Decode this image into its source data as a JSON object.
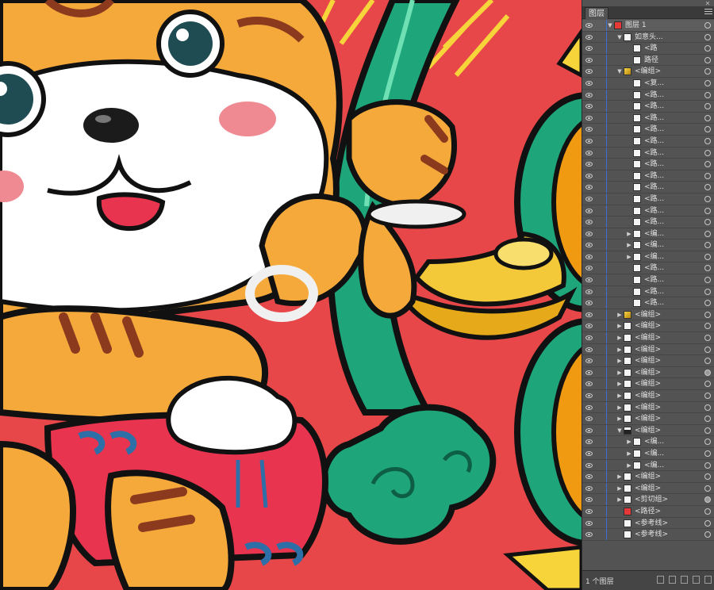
{
  "panel": {
    "tab_label": "图层",
    "close_glyph": "✕",
    "footer_count": "1 个图层",
    "layers": [
      {
        "label": "图层 1",
        "indent": 0,
        "toggle": "▼",
        "thumb": "red",
        "target": "open"
      },
      {
        "label": "如意头...",
        "indent": 1,
        "toggle": "▼",
        "thumb": "plain",
        "target": "open"
      },
      {
        "label": "<路",
        "indent": 2,
        "toggle": "",
        "thumb": "plain",
        "target": "open"
      },
      {
        "label": "路径",
        "indent": 2,
        "toggle": "",
        "thumb": "plain",
        "target": "open"
      },
      {
        "label": "<编组>",
        "indent": 1,
        "toggle": "▼",
        "thumb": "gold",
        "target": "open"
      },
      {
        "label": "<复...",
        "indent": 2,
        "toggle": "",
        "thumb": "plain",
        "target": "open"
      },
      {
        "label": "<路...",
        "indent": 2,
        "toggle": "",
        "thumb": "plain",
        "target": "open"
      },
      {
        "label": "<路...",
        "indent": 2,
        "toggle": "",
        "thumb": "plain",
        "target": "open"
      },
      {
        "label": "<路...",
        "indent": 2,
        "toggle": "",
        "thumb": "plain",
        "target": "open"
      },
      {
        "label": "<路...",
        "indent": 2,
        "toggle": "",
        "thumb": "plain",
        "target": "open"
      },
      {
        "label": "<路...",
        "indent": 2,
        "toggle": "",
        "thumb": "plain",
        "target": "open"
      },
      {
        "label": "<路...",
        "indent": 2,
        "toggle": "",
        "thumb": "plain",
        "target": "open"
      },
      {
        "label": "<路...",
        "indent": 2,
        "toggle": "",
        "thumb": "plain",
        "target": "open"
      },
      {
        "label": "<路...",
        "indent": 2,
        "toggle": "",
        "thumb": "plain",
        "target": "open"
      },
      {
        "label": "<路...",
        "indent": 2,
        "toggle": "",
        "thumb": "plain",
        "target": "open"
      },
      {
        "label": "<路...",
        "indent": 2,
        "toggle": "",
        "thumb": "plain",
        "target": "open"
      },
      {
        "label": "<路...",
        "indent": 2,
        "toggle": "",
        "thumb": "plain",
        "target": "open"
      },
      {
        "label": "<路...",
        "indent": 2,
        "toggle": "",
        "thumb": "plain",
        "target": "open"
      },
      {
        "label": "<编...",
        "indent": 2,
        "toggle": "▶",
        "thumb": "plain",
        "target": "open"
      },
      {
        "label": "<编...",
        "indent": 2,
        "toggle": "▶",
        "thumb": "plain",
        "target": "open"
      },
      {
        "label": "<编...",
        "indent": 2,
        "toggle": "▶",
        "thumb": "plain",
        "target": "open"
      },
      {
        "label": "<路...",
        "indent": 2,
        "toggle": "",
        "thumb": "plain",
        "target": "open"
      },
      {
        "label": "<路...",
        "indent": 2,
        "toggle": "",
        "thumb": "plain",
        "target": "open"
      },
      {
        "label": "<路...",
        "indent": 2,
        "toggle": "",
        "thumb": "plain",
        "target": "open"
      },
      {
        "label": "<路...",
        "indent": 2,
        "toggle": "",
        "thumb": "plain",
        "target": "open"
      },
      {
        "label": "<编组>",
        "indent": 1,
        "toggle": "▶",
        "thumb": "gold",
        "target": "open"
      },
      {
        "label": "<编组>",
        "indent": 1,
        "toggle": "▶",
        "thumb": "plain",
        "target": "open"
      },
      {
        "label": "<编组>",
        "indent": 1,
        "toggle": "▶",
        "thumb": "plain",
        "target": "open"
      },
      {
        "label": "<编组>",
        "indent": 1,
        "toggle": "▶",
        "thumb": "plain",
        "target": "open"
      },
      {
        "label": "<编组>",
        "indent": 1,
        "toggle": "▶",
        "thumb": "plain",
        "target": "open"
      },
      {
        "label": "<编组>",
        "indent": 1,
        "toggle": "▶",
        "thumb": "plain",
        "target": "filled"
      },
      {
        "label": "<编组>",
        "indent": 1,
        "toggle": "▶",
        "thumb": "plain",
        "target": "open"
      },
      {
        "label": "<编组>",
        "indent": 1,
        "toggle": "▶",
        "thumb": "plain",
        "target": "open"
      },
      {
        "label": "<编组>",
        "indent": 1,
        "toggle": "▶",
        "thumb": "plain",
        "target": "open"
      },
      {
        "label": "<编组>",
        "indent": 1,
        "toggle": "▶",
        "thumb": "plain",
        "target": "open"
      },
      {
        "label": "<编组>",
        "indent": 1,
        "toggle": "▼",
        "thumb": "dark",
        "target": "open"
      },
      {
        "label": "<编...",
        "indent": 2,
        "toggle": "▶",
        "thumb": "plain",
        "target": "open"
      },
      {
        "label": "<编...",
        "indent": 2,
        "toggle": "▶",
        "thumb": "plain",
        "target": "open"
      },
      {
        "label": "<编...",
        "indent": 2,
        "toggle": "▶",
        "thumb": "plain",
        "target": "open"
      },
      {
        "label": "<编组>",
        "indent": 1,
        "toggle": "▶",
        "thumb": "plain",
        "target": "open"
      },
      {
        "label": "<编组>",
        "indent": 1,
        "toggle": "▶",
        "thumb": "plain",
        "target": "open"
      },
      {
        "label": "<剪切组>",
        "indent": 1,
        "toggle": "▶",
        "thumb": "plain",
        "target": "filled"
      },
      {
        "label": "<路径>",
        "indent": 1,
        "toggle": "",
        "thumb": "red",
        "target": "open"
      },
      {
        "label": "<参考线>",
        "indent": 1,
        "toggle": "",
        "thumb": "plain",
        "target": "open"
      },
      {
        "label": "<参考线>",
        "indent": 1,
        "toggle": "",
        "thumb": "plain",
        "target": "open"
      }
    ]
  },
  "colors": {
    "background": "#e8474a",
    "tiger_orange": "#f6a93b",
    "tiger_stripe": "#8b3a1e",
    "fur_white": "#ffffff",
    "scepter_green": "#1fa57a",
    "gold": "#f3c93a",
    "coin_orange": "#f09a12",
    "vest_red": "#e8344e",
    "wave_blue": "#2f6fa8",
    "panel_bg": "#535353",
    "layer_line": "#3c6fd9"
  }
}
